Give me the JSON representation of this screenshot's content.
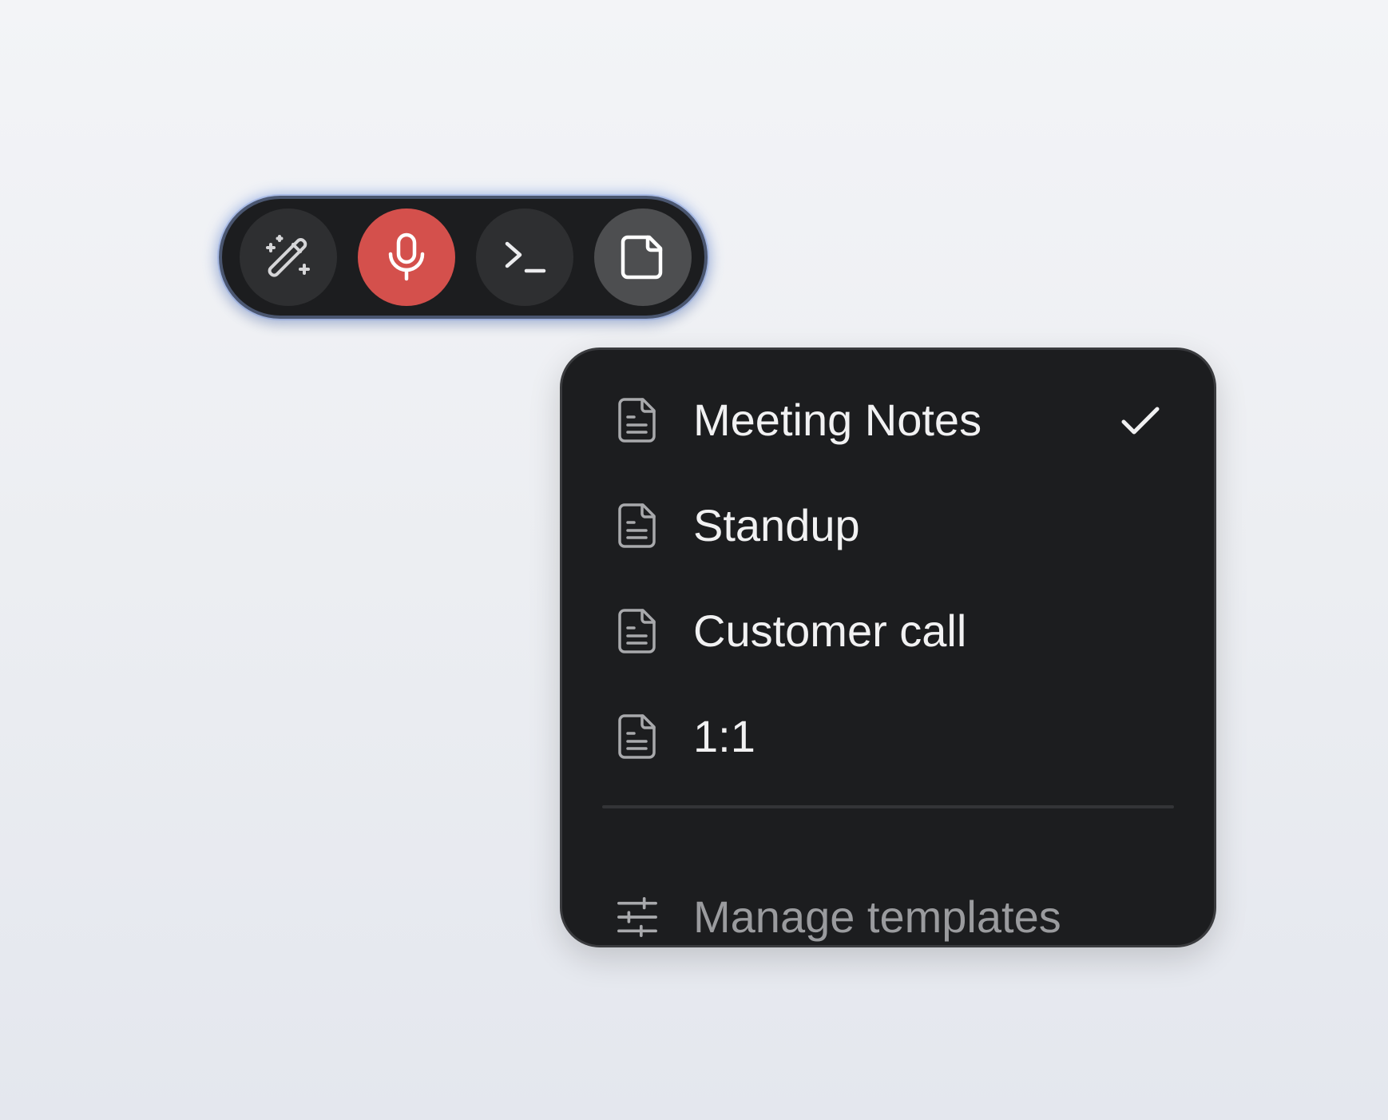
{
  "toolbar": {
    "buttons": [
      {
        "name": "magic-wand-button",
        "icon": "magic-wand-icon",
        "state": "default"
      },
      {
        "name": "record-button",
        "icon": "microphone-icon",
        "state": "recording",
        "color": "#d4504c"
      },
      {
        "name": "terminal-button",
        "icon": "terminal-icon",
        "state": "default"
      },
      {
        "name": "template-button",
        "icon": "note-icon",
        "state": "active"
      }
    ]
  },
  "menu": {
    "items": [
      {
        "label": "Meeting Notes",
        "icon": "document-icon",
        "selected": true
      },
      {
        "label": "Standup",
        "icon": "document-icon",
        "selected": false
      },
      {
        "label": "Customer call",
        "icon": "document-icon",
        "selected": false
      },
      {
        "label": "1:1",
        "icon": "document-icon",
        "selected": false
      }
    ],
    "manage": {
      "label": "Manage templates",
      "icon": "sliders-icon"
    }
  },
  "colors": {
    "surface": "#1c1d1f",
    "button": "#2e2f31",
    "button_active": "#4d4e50",
    "record": "#d4504c",
    "text": "#f1f1f2",
    "text_muted": "#9a9b9e",
    "glow": "#6e96eb"
  }
}
